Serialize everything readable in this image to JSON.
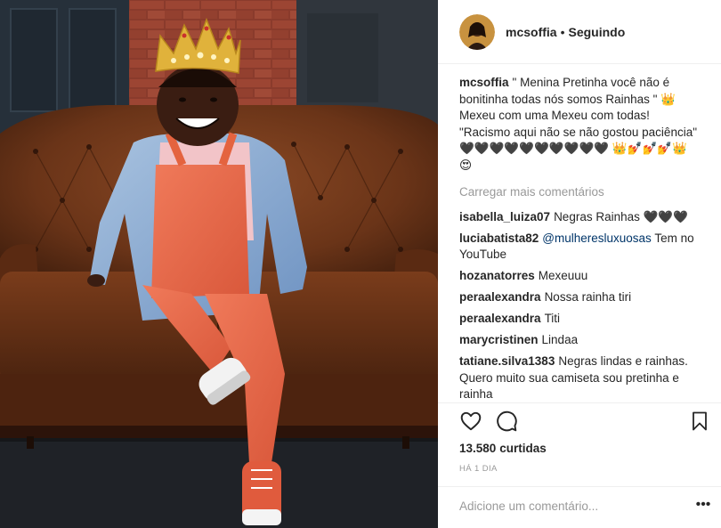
{
  "post": {
    "username": "mcsoffia",
    "follow_status": "Seguindo",
    "separator": "•",
    "caption": {
      "username": "mcsoffia",
      "text": "\" Menina Pretinha você não é bonitinha todas nós somos Rainhas \" 👑 Mexeu com uma Mexeu com todas! \"Racismo aqui não se não gostou paciência\" 🖤🖤🖤🖤🖤🖤🖤🖤🖤🖤 👑💅💅💅👑😍"
    },
    "load_more_label": "Carregar mais comentários",
    "comments": [
      {
        "user": "isabella_luiza07",
        "text": "Negras Rainhas 🖤🖤🖤"
      },
      {
        "user": "luciabatista82",
        "mention": "@mulheresluxuosas",
        "text": " Tem no YouTube"
      },
      {
        "user": "hozanatorres",
        "text": "Mexeuuu"
      },
      {
        "user": "peraalexandra",
        "text": "Nossa rainha tiri"
      },
      {
        "user": "peraalexandra",
        "text": "Titi"
      },
      {
        "user": "marycristinen",
        "text": "Lindaa"
      },
      {
        "user": "tatiane.silva1383",
        "text": "Negras lindas e rainhas. Quero muito sua camiseta sou pretinha e rainha"
      }
    ],
    "likes_count": "13.580",
    "likes_label": "curtidas",
    "time_ago": "HÁ 1 DIA",
    "comment_placeholder": "Adicione um comentário...",
    "more_glyph": "•••"
  },
  "icons": {
    "like": "heart-outline-icon",
    "comment": "speech-bubble-icon",
    "save": "bookmark-icon",
    "more": "more-options-icon"
  },
  "colors": {
    "text": "#262626",
    "muted": "#999999",
    "mention": "#003569",
    "divider": "#efefef"
  }
}
